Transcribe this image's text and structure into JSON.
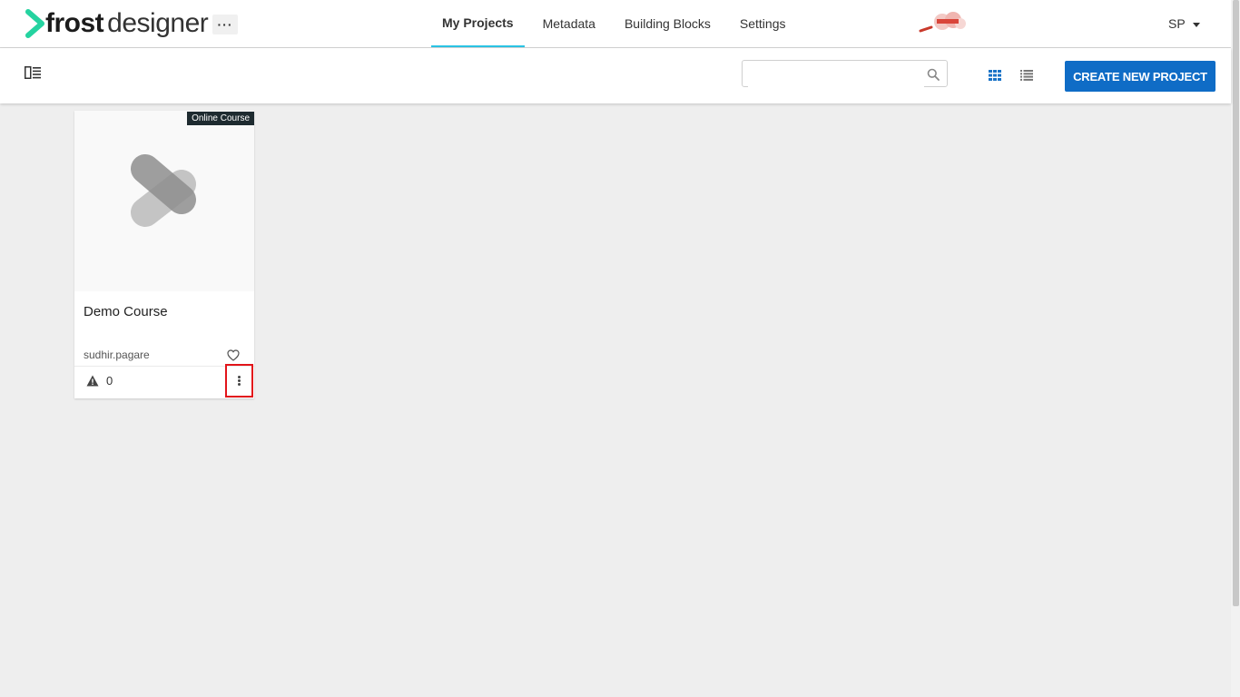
{
  "app": {
    "logo_bold": "frost",
    "logo_light": "designer",
    "more_label": "···",
    "accent_color": "#2bc4e5",
    "brand_mark_icon": "partner-logo-icon"
  },
  "nav": {
    "items": [
      {
        "label": "My Projects",
        "active": true
      },
      {
        "label": "Metadata",
        "active": false
      },
      {
        "label": "Building Blocks",
        "active": false
      },
      {
        "label": "Settings",
        "active": false
      }
    ]
  },
  "user": {
    "initials": "SP"
  },
  "toolbar": {
    "search_placeholder": "",
    "create_label": "CREATE NEW PROJECT",
    "create_color": "#0f6cc6",
    "grid_icon": "grid-view-icon",
    "list_icon": "list-view-icon"
  },
  "projects": [
    {
      "title": "Demo Course",
      "badge": "Online Course",
      "owner": "sudhir.pagare",
      "warnings": "0"
    }
  ]
}
